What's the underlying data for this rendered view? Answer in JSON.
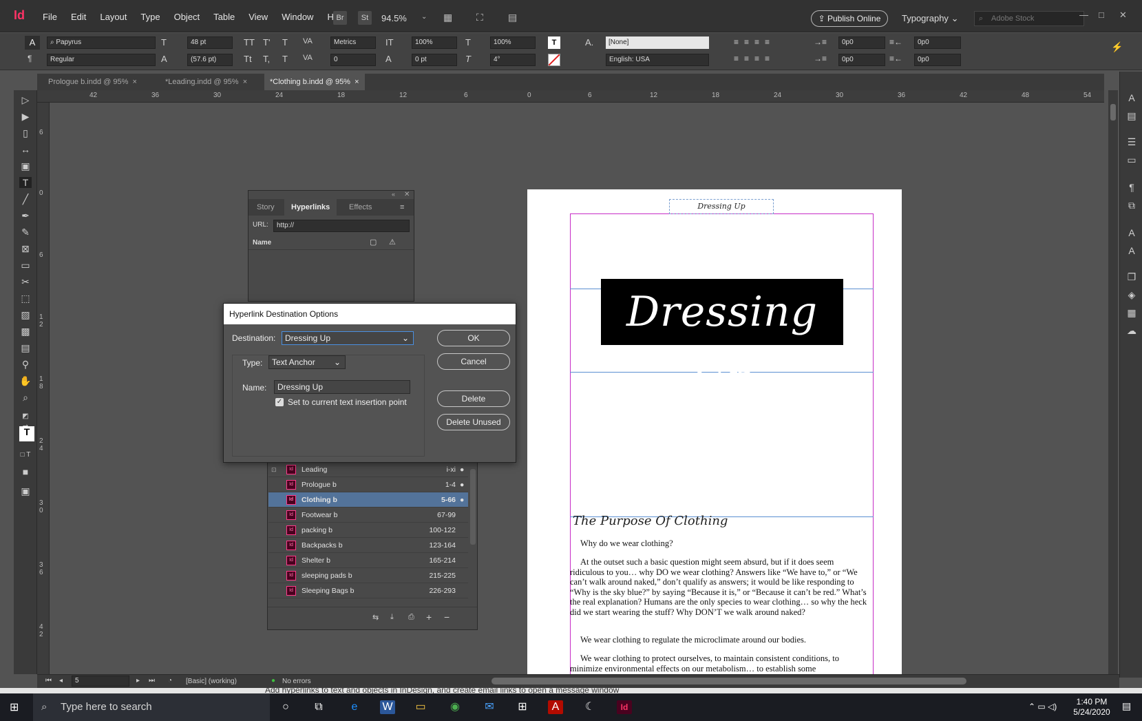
{
  "app": {
    "logo": "Id",
    "menus": [
      "File",
      "Edit",
      "Layout",
      "Type",
      "Object",
      "Table",
      "View",
      "Window",
      "Help"
    ],
    "bridge": "Br",
    "stock_btn": "St",
    "zoom": "94.5%",
    "publish": "Publish Online",
    "workspace": "Typography",
    "stock_search_placeholder": "Adobe Stock"
  },
  "control": {
    "font_family": "Papyrus",
    "font_style": "Regular",
    "font_size": "48 pt",
    "leading": "(57.6 pt)",
    "kerning": "Metrics",
    "tracking": "0",
    "vscale": "100%",
    "hscale": "100%",
    "baseline": "0 pt",
    "skew": "4°",
    "char_style": "[None]",
    "language": "English: USA",
    "indent_l": "0p0",
    "indent_r": "0p0",
    "space_b": "0p0",
    "space_a": "0p0",
    "indent_f": "0p0",
    "indent_last": "0p0"
  },
  "tabs": [
    {
      "label": "Prologue b.indd @ 95%",
      "close": "×"
    },
    {
      "label": "*Leading.indd @ 95%",
      "close": "×"
    },
    {
      "label": "*Clothing b.indd @ 95%",
      "close": "×"
    }
  ],
  "ruler_h": [
    "42",
    "36",
    "30",
    "24",
    "18",
    "12",
    "6",
    "0",
    "6",
    "12",
    "18",
    "24",
    "30",
    "36",
    "42",
    "48",
    "54"
  ],
  "ruler_v": [
    "6",
    "0",
    "6",
    "1 2",
    "1 8",
    "2 4",
    "3 0",
    "3 6",
    "4 2"
  ],
  "hyperlinks_panel": {
    "tabs": [
      "Story",
      "Hyperlinks",
      "Effects"
    ],
    "url_label": "URL:",
    "url_value": "http://",
    "name_header": "Name"
  },
  "dialog": {
    "title": "Hyperlink Destination Options",
    "destination_label": "Destination:",
    "destination_value": "Dressing Up",
    "type_label": "Type:",
    "type_value": "Text Anchor",
    "name_label": "Name:",
    "name_value": "Dressing Up",
    "checkbox_label": "Set to current text insertion point",
    "ok": "OK",
    "cancel": "Cancel",
    "delete": "Delete",
    "delete_unused": "Delete Unused"
  },
  "book": {
    "rows": [
      {
        "name": "Leading",
        "pages": "i-xi"
      },
      {
        "name": "Prologue b",
        "pages": "1-4"
      },
      {
        "name": "Clothing b",
        "pages": "5-66"
      },
      {
        "name": "Footwear b",
        "pages": "67-99"
      },
      {
        "name": "packing b",
        "pages": "100-122"
      },
      {
        "name": "Backpacks b",
        "pages": "123-164"
      },
      {
        "name": "Shelter b",
        "pages": "165-214"
      },
      {
        "name": "sleeping pads b",
        "pages": "215-225"
      },
      {
        "name": "Sleeping Bags b",
        "pages": "226-293"
      }
    ]
  },
  "page": {
    "running_header": "Dressing Up",
    "banner": "Dressing Up",
    "heading": "The Purpose Of Clothing",
    "p1": "Why do we wear clothing?",
    "p2": "At the outset such a basic question might seem absurd, but if it does seem ridiculous to you… why DO we wear clothing? Answers like “We have to,” or “We can’t walk around naked,” don’t qualify as answers; it would be like responding to “Why is the sky blue?” by saying “Because it is,” or “Because it can’t be red.” What’s the real explanation? Humans are the only species to wear clothing… so why the heck did we start wearing the stuff? Why DON’T we walk around naked?",
    "p3": "We wear clothing to regulate the microclimate around our bodies.",
    "p4": "We wear clothing to protect ourselves, to maintain consistent conditions, to minimize environmental effects on our metabolism… to establish some"
  },
  "status": {
    "page_num": "5",
    "master": "[Basic] (working)",
    "preflight": "No errors"
  },
  "caption": "Add hyperlinks to text and objects in InDesign, and create email links to open a message window",
  "taskbar": {
    "search_placeholder": "Type here to search",
    "time": "1:40 PM",
    "date": "5/24/2020"
  },
  "colors": {
    "accent_pink": "#ff3366",
    "selection_blue": "#53739a",
    "margin_magenta": "#c62bc6",
    "guide_blue": "#5a8fd1",
    "ok_green": "#3fbf3f"
  }
}
